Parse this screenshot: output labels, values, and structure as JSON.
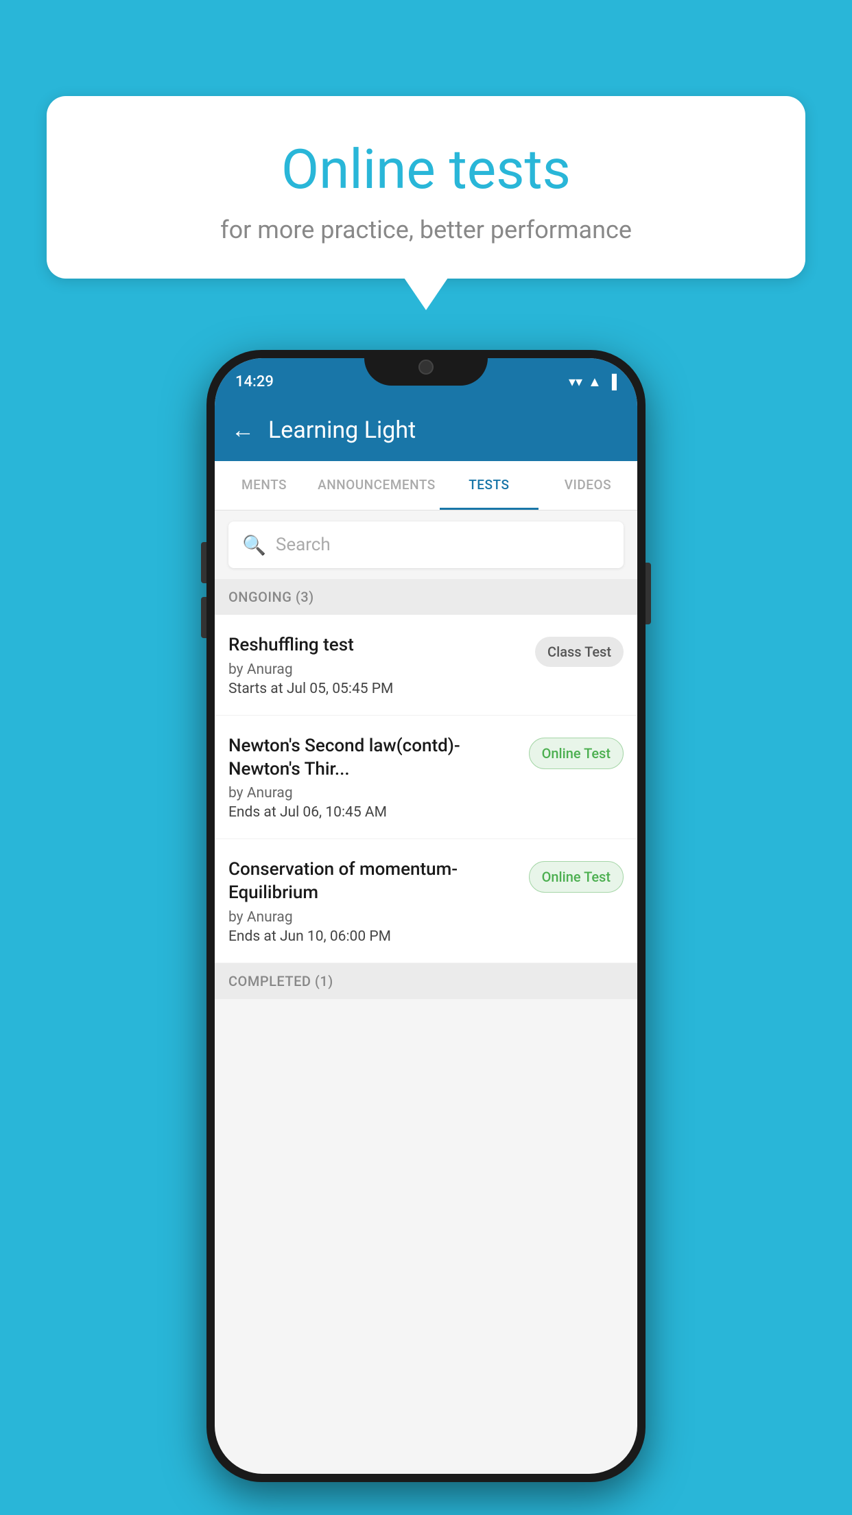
{
  "background_color": "#29b6d8",
  "bubble": {
    "title": "Online tests",
    "subtitle": "for more practice, better performance"
  },
  "status_bar": {
    "time": "14:29",
    "wifi": "▼",
    "signal": "▲",
    "battery": "▐"
  },
  "app_bar": {
    "title": "Learning Light",
    "back_label": "←"
  },
  "tabs": [
    {
      "label": "MENTS",
      "active": false
    },
    {
      "label": "ANNOUNCEMENTS",
      "active": false
    },
    {
      "label": "TESTS",
      "active": true
    },
    {
      "label": "VIDEOS",
      "active": false
    }
  ],
  "search": {
    "placeholder": "Search"
  },
  "sections": [
    {
      "header": "ONGOING (3)",
      "tests": [
        {
          "title": "Reshuffling test",
          "author": "by Anurag",
          "time_label": "Starts at",
          "time": "Jul 05, 05:45 PM",
          "badge": "Class Test",
          "badge_type": "class"
        },
        {
          "title": "Newton's Second law(contd)-Newton's Thir...",
          "author": "by Anurag",
          "time_label": "Ends at",
          "time": "Jul 06, 10:45 AM",
          "badge": "Online Test",
          "badge_type": "online"
        },
        {
          "title": "Conservation of momentum-Equilibrium",
          "author": "by Anurag",
          "time_label": "Ends at",
          "time": "Jun 10, 06:00 PM",
          "badge": "Online Test",
          "badge_type": "online"
        }
      ]
    }
  ],
  "completed_section": {
    "header": "COMPLETED (1)"
  }
}
